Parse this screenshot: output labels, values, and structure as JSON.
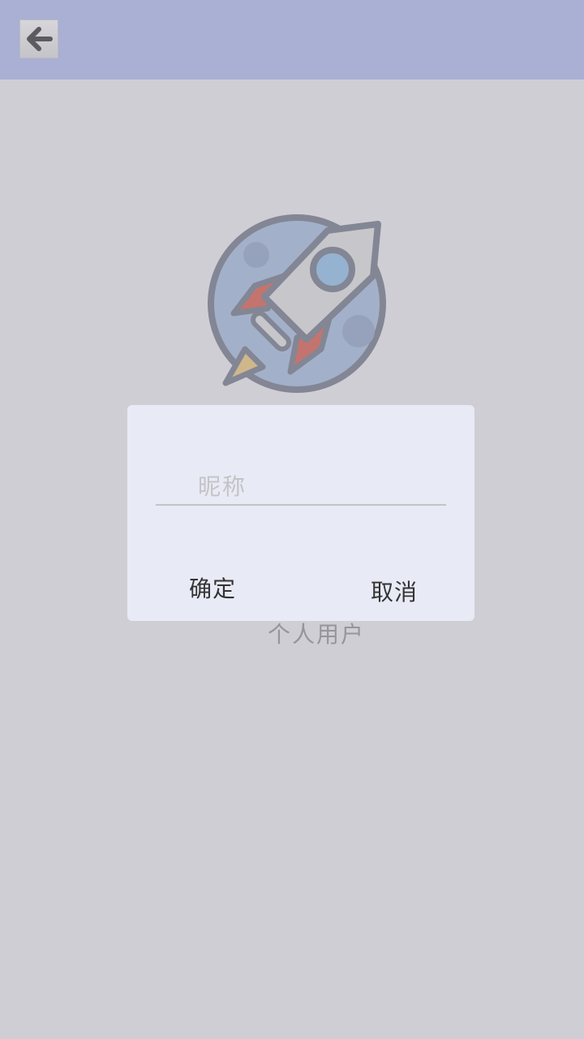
{
  "header": {
    "back_icon": "arrow-left-icon"
  },
  "profile": {
    "logo_icon": "rocket-icon",
    "user_type": "个人用户"
  },
  "dialog": {
    "nickname_placeholder": "昵称",
    "nickname_value": "",
    "confirm_label": "确定",
    "cancel_label": "取消"
  },
  "colors": {
    "appbar": "#bcc8f7",
    "background": "#f3f3f8",
    "dialog": "#e8eaf6",
    "scrim": "rgba(130,128,140,0.32)"
  }
}
